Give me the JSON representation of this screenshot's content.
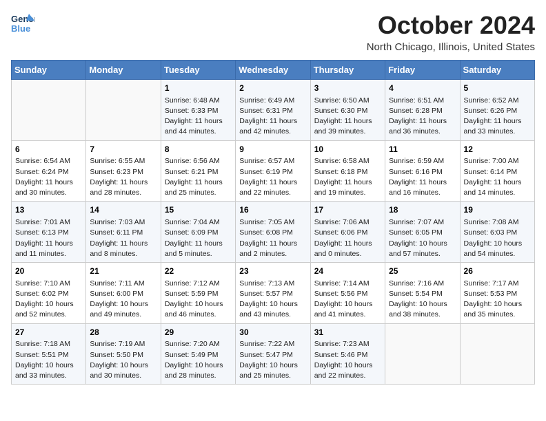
{
  "header": {
    "logo_line1": "General",
    "logo_line2": "Blue",
    "month_title": "October 2024",
    "location": "North Chicago, Illinois, United States"
  },
  "days_of_week": [
    "Sunday",
    "Monday",
    "Tuesday",
    "Wednesday",
    "Thursday",
    "Friday",
    "Saturday"
  ],
  "weeks": [
    [
      {
        "num": "",
        "sunrise": "",
        "sunset": "",
        "daylight": ""
      },
      {
        "num": "",
        "sunrise": "",
        "sunset": "",
        "daylight": ""
      },
      {
        "num": "1",
        "sunrise": "Sunrise: 6:48 AM",
        "sunset": "Sunset: 6:33 PM",
        "daylight": "Daylight: 11 hours and 44 minutes."
      },
      {
        "num": "2",
        "sunrise": "Sunrise: 6:49 AM",
        "sunset": "Sunset: 6:31 PM",
        "daylight": "Daylight: 11 hours and 42 minutes."
      },
      {
        "num": "3",
        "sunrise": "Sunrise: 6:50 AM",
        "sunset": "Sunset: 6:30 PM",
        "daylight": "Daylight: 11 hours and 39 minutes."
      },
      {
        "num": "4",
        "sunrise": "Sunrise: 6:51 AM",
        "sunset": "Sunset: 6:28 PM",
        "daylight": "Daylight: 11 hours and 36 minutes."
      },
      {
        "num": "5",
        "sunrise": "Sunrise: 6:52 AM",
        "sunset": "Sunset: 6:26 PM",
        "daylight": "Daylight: 11 hours and 33 minutes."
      }
    ],
    [
      {
        "num": "6",
        "sunrise": "Sunrise: 6:54 AM",
        "sunset": "Sunset: 6:24 PM",
        "daylight": "Daylight: 11 hours and 30 minutes."
      },
      {
        "num": "7",
        "sunrise": "Sunrise: 6:55 AM",
        "sunset": "Sunset: 6:23 PM",
        "daylight": "Daylight: 11 hours and 28 minutes."
      },
      {
        "num": "8",
        "sunrise": "Sunrise: 6:56 AM",
        "sunset": "Sunset: 6:21 PM",
        "daylight": "Daylight: 11 hours and 25 minutes."
      },
      {
        "num": "9",
        "sunrise": "Sunrise: 6:57 AM",
        "sunset": "Sunset: 6:19 PM",
        "daylight": "Daylight: 11 hours and 22 minutes."
      },
      {
        "num": "10",
        "sunrise": "Sunrise: 6:58 AM",
        "sunset": "Sunset: 6:18 PM",
        "daylight": "Daylight: 11 hours and 19 minutes."
      },
      {
        "num": "11",
        "sunrise": "Sunrise: 6:59 AM",
        "sunset": "Sunset: 6:16 PM",
        "daylight": "Daylight: 11 hours and 16 minutes."
      },
      {
        "num": "12",
        "sunrise": "Sunrise: 7:00 AM",
        "sunset": "Sunset: 6:14 PM",
        "daylight": "Daylight: 11 hours and 14 minutes."
      }
    ],
    [
      {
        "num": "13",
        "sunrise": "Sunrise: 7:01 AM",
        "sunset": "Sunset: 6:13 PM",
        "daylight": "Daylight: 11 hours and 11 minutes."
      },
      {
        "num": "14",
        "sunrise": "Sunrise: 7:03 AM",
        "sunset": "Sunset: 6:11 PM",
        "daylight": "Daylight: 11 hours and 8 minutes."
      },
      {
        "num": "15",
        "sunrise": "Sunrise: 7:04 AM",
        "sunset": "Sunset: 6:09 PM",
        "daylight": "Daylight: 11 hours and 5 minutes."
      },
      {
        "num": "16",
        "sunrise": "Sunrise: 7:05 AM",
        "sunset": "Sunset: 6:08 PM",
        "daylight": "Daylight: 11 hours and 2 minutes."
      },
      {
        "num": "17",
        "sunrise": "Sunrise: 7:06 AM",
        "sunset": "Sunset: 6:06 PM",
        "daylight": "Daylight: 11 hours and 0 minutes."
      },
      {
        "num": "18",
        "sunrise": "Sunrise: 7:07 AM",
        "sunset": "Sunset: 6:05 PM",
        "daylight": "Daylight: 10 hours and 57 minutes."
      },
      {
        "num": "19",
        "sunrise": "Sunrise: 7:08 AM",
        "sunset": "Sunset: 6:03 PM",
        "daylight": "Daylight: 10 hours and 54 minutes."
      }
    ],
    [
      {
        "num": "20",
        "sunrise": "Sunrise: 7:10 AM",
        "sunset": "Sunset: 6:02 PM",
        "daylight": "Daylight: 10 hours and 52 minutes."
      },
      {
        "num": "21",
        "sunrise": "Sunrise: 7:11 AM",
        "sunset": "Sunset: 6:00 PM",
        "daylight": "Daylight: 10 hours and 49 minutes."
      },
      {
        "num": "22",
        "sunrise": "Sunrise: 7:12 AM",
        "sunset": "Sunset: 5:59 PM",
        "daylight": "Daylight: 10 hours and 46 minutes."
      },
      {
        "num": "23",
        "sunrise": "Sunrise: 7:13 AM",
        "sunset": "Sunset: 5:57 PM",
        "daylight": "Daylight: 10 hours and 43 minutes."
      },
      {
        "num": "24",
        "sunrise": "Sunrise: 7:14 AM",
        "sunset": "Sunset: 5:56 PM",
        "daylight": "Daylight: 10 hours and 41 minutes."
      },
      {
        "num": "25",
        "sunrise": "Sunrise: 7:16 AM",
        "sunset": "Sunset: 5:54 PM",
        "daylight": "Daylight: 10 hours and 38 minutes."
      },
      {
        "num": "26",
        "sunrise": "Sunrise: 7:17 AM",
        "sunset": "Sunset: 5:53 PM",
        "daylight": "Daylight: 10 hours and 35 minutes."
      }
    ],
    [
      {
        "num": "27",
        "sunrise": "Sunrise: 7:18 AM",
        "sunset": "Sunset: 5:51 PM",
        "daylight": "Daylight: 10 hours and 33 minutes."
      },
      {
        "num": "28",
        "sunrise": "Sunrise: 7:19 AM",
        "sunset": "Sunset: 5:50 PM",
        "daylight": "Daylight: 10 hours and 30 minutes."
      },
      {
        "num": "29",
        "sunrise": "Sunrise: 7:20 AM",
        "sunset": "Sunset: 5:49 PM",
        "daylight": "Daylight: 10 hours and 28 minutes."
      },
      {
        "num": "30",
        "sunrise": "Sunrise: 7:22 AM",
        "sunset": "Sunset: 5:47 PM",
        "daylight": "Daylight: 10 hours and 25 minutes."
      },
      {
        "num": "31",
        "sunrise": "Sunrise: 7:23 AM",
        "sunset": "Sunset: 5:46 PM",
        "daylight": "Daylight: 10 hours and 22 minutes."
      },
      {
        "num": "",
        "sunrise": "",
        "sunset": "",
        "daylight": ""
      },
      {
        "num": "",
        "sunrise": "",
        "sunset": "",
        "daylight": ""
      }
    ]
  ]
}
